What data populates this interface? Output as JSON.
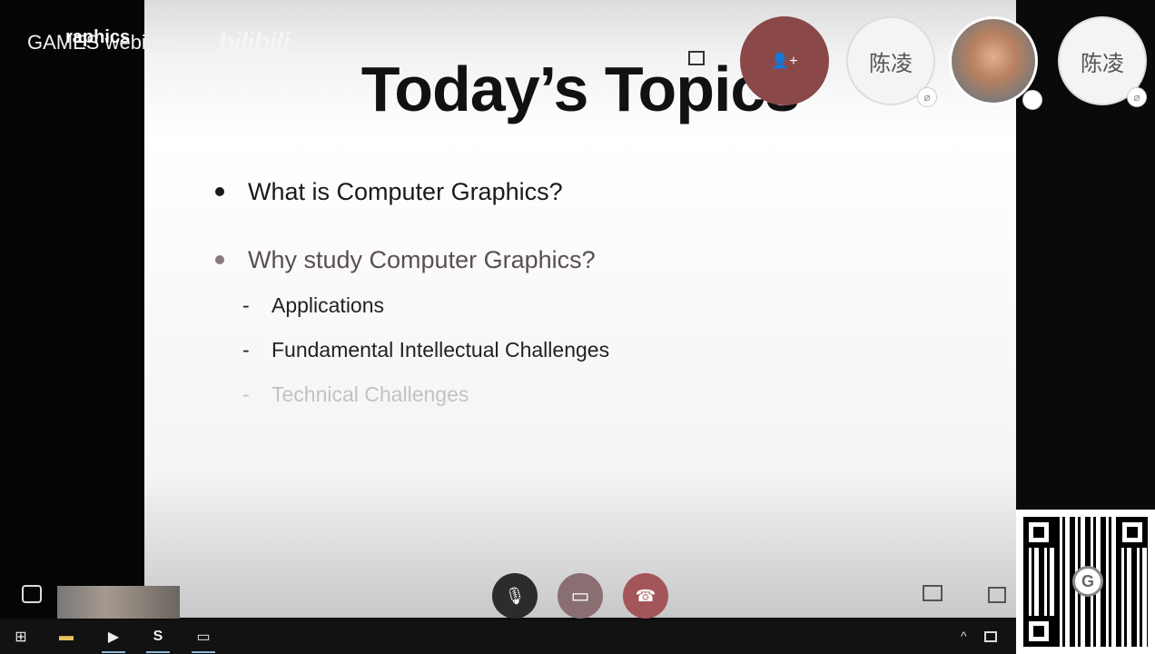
{
  "slide": {
    "title": "Today’s Topics",
    "bullets": [
      {
        "text": "What is Computer Graphics?"
      },
      {
        "text": "Why study Computer Graphics?"
      }
    ],
    "sub_items": [
      {
        "text": "Applications"
      },
      {
        "text": "Fundamental Intellectual Challenges"
      },
      {
        "text": "Technical Challenges"
      }
    ],
    "dash": "-"
  },
  "overlay": {
    "brand_text": "GAMES webinar",
    "brand_over": "raphics",
    "bilibili": "bilibili"
  },
  "participants": [
    {
      "name": "陈凌"
    },
    {
      "name": "陈凌"
    }
  ],
  "icons": {
    "add_participant": "👤+",
    "mic_off": "⌀",
    "mic": "🎙",
    "camera_off": "▭",
    "hang_up": "☎",
    "windows": "⊞",
    "folder": "▬",
    "media": "▶",
    "skype": "S",
    "window": "▭",
    "tray_up": "^",
    "qr_logo": "G"
  },
  "colors": {
    "hang_up": "#a3555a",
    "camera": "#8a6f72",
    "mic": "#2c2c2c"
  }
}
